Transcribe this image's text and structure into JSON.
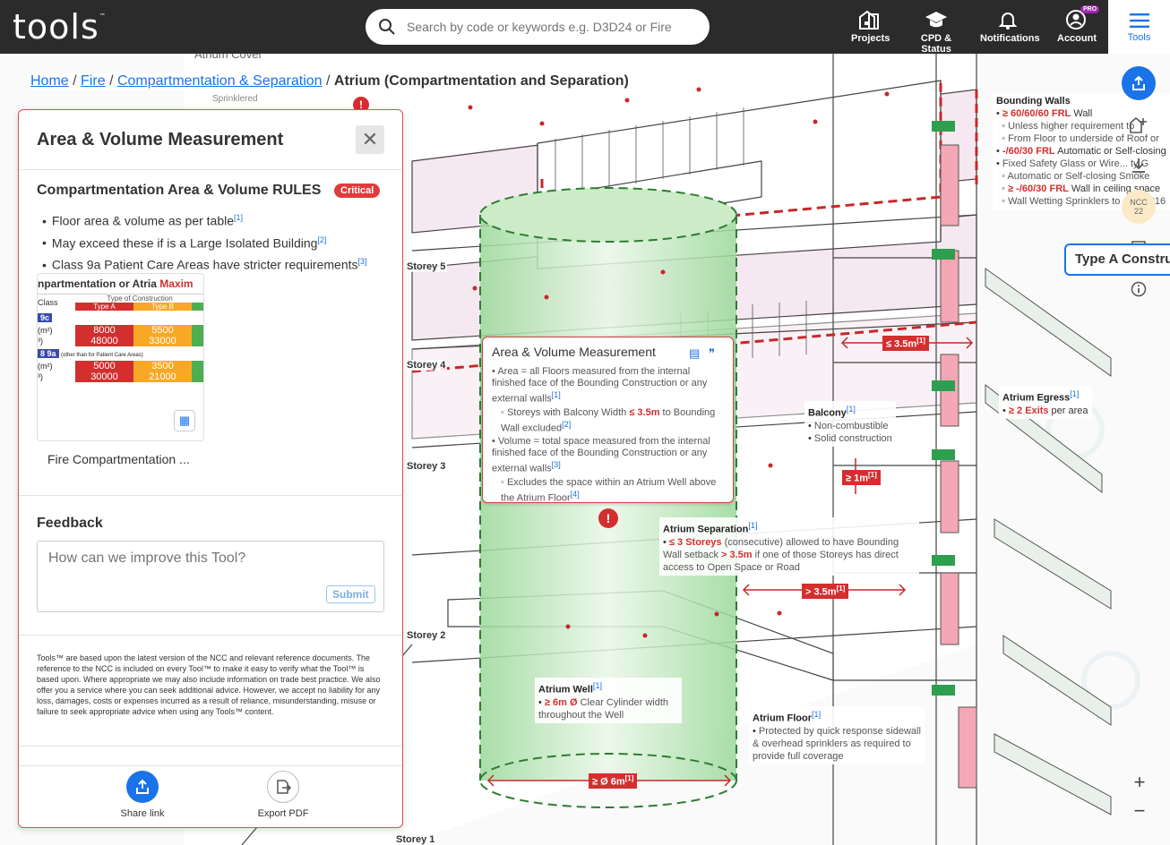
{
  "header": {
    "logo": "tools",
    "logo_tm": "™",
    "search_placeholder": "Search by code or keywords e.g. D3D24 or Fire",
    "nav": [
      {
        "label": "Projects"
      },
      {
        "label": "CPD & Status"
      },
      {
        "label": "Notifications"
      },
      {
        "label": "Account",
        "badge": "PRO"
      }
    ],
    "tools_label": "Tools"
  },
  "breadcrumb": {
    "home": "Home",
    "sep": "/",
    "fire": "Fire",
    "compartmentation": "Compartmentation & Separation",
    "current": "Atrium (Compartmentation and Separation)"
  },
  "panel": {
    "title": "Area & Volume Measurement",
    "rules_title": "Compartmentation Area & Volume RULES",
    "badge": "Critical",
    "rules": [
      {
        "text": "Floor area & volume as per table",
        "ref": "[1]"
      },
      {
        "text": "May exceed these if is a Large Isolated Building",
        "ref": "[2]"
      },
      {
        "text": "Class 9a Patient Care Areas have stricter requirements",
        "ref": "[3]"
      }
    ],
    "thumb": {
      "title_a": "npartmentation or Atria",
      "title_b": "Maxim",
      "class": "Class",
      "type_of_construction": "Type of Construction",
      "type_a": "Type A",
      "type_b": "Type B",
      "row1_label": "9c",
      "r1a_unit": "(m²)",
      "r1a_a": "8000",
      "r1a_b": "5500",
      "r1b_unit": "³)",
      "r1b_a": "48000",
      "r1b_b": "33000",
      "row2_label": "8 9a",
      "row2_note": "(other than for Patient Care Areas)",
      "r2a_unit": "(m²)",
      "r2a_a": "5000",
      "r2a_b": "3500",
      "r2b_unit": "³)",
      "r2b_a": "30000",
      "r2b_b": "21000"
    },
    "thumb_caption": "Fire Compartmentation ...",
    "feedback_title": "Feedback",
    "feedback_placeholder": "How can we improve this Tool?",
    "submit_label": "Submit",
    "disclaimer": "Tools™ are based upon the latest version of the NCC and relevant reference documents. The reference to the NCC is included on every Tool™ to make it easy to verify what the Tool™ is based upon. Where appropriate we may also include information on trade best practice. We also offer you a service where you can seek additional advice. However, we accept no liability for any loss, damages, costs or expenses incurred as a result of reliance, misunderstanding, misuse or failure to seek appropriate advice when using any Tools™ content.",
    "share_label": "Share link",
    "export_label": "Export PDF"
  },
  "right_tools": {
    "ncc_label": "NCC",
    "ncc_year": "22",
    "type_a_label": "Type A Construc"
  },
  "diagram": {
    "bg_label_1": "Atrium Cover",
    "bg_label_2": "Sprinklered",
    "storeys": [
      "Storey 5",
      "Storey 4",
      "Storey 3",
      "Storey 2",
      "Storey 1"
    ],
    "popup": {
      "title": "Area & Volume Measurement",
      "b1": "Area = all Floors measured from the internal finished face of the Bounding Construction or any external walls",
      "b1_ref": "[1]",
      "b1_sub_a": "Storeys with Balcony Width",
      "b1_sub_val": "≤ 3.5m",
      "b1_sub_b": "to Bounding Wall excluded",
      "b1_sub_ref": "[2]",
      "b2": "Volume = total space measured from the internal finished face of the Bounding Construction or any external walls",
      "b2_ref": "[3]",
      "b2_sub": "Excludes the space within an Atrium Well above the Atrium Floor",
      "b2_sub_ref": "[4]"
    },
    "bounding_walls": {
      "title": "Bounding Walls",
      "l1": "≥ 60/60/60 FRL",
      "l1b": "Wall",
      "l2": "Unless higher requirement to",
      "l3": "From Floor to underside of Roof or",
      "l4": "-/60/30 FRL",
      "l4b": "Automatic or Self-closing",
      "l5": "Fixed Safety Glass or Wire... ty G",
      "l6": "Automatic or Self-closing Smoke",
      "l7": "≥ -/60/30 FRL",
      "l7b": "Wall in ceiling space",
      "l8": "Wall Wetting Sprinklers to ... C 2016"
    },
    "atrium_egress": {
      "title": "Atrium Egress",
      "ref": "[1]",
      "val": "≥ 2 Exits",
      "rest": "per area"
    },
    "balcony": {
      "title": "Balcony",
      "ref": "[1]",
      "l1": "Non-combustible",
      "l2": "Solid construction"
    },
    "atrium_separation": {
      "title": "Atrium Separation",
      "ref": "[1]",
      "val": "≤ 3 Storeys",
      "t1": "(consecutive) allowed to have Bounding Wall setback",
      "val2": "> 3.5m",
      "t2": "if one of those Storeys has direct access to Open Space or Road"
    },
    "atrium_well": {
      "title": "Atrium Well",
      "ref": "[1]",
      "val": "≥ 6m Ø",
      "rest": "Clear Cylinder width throughout the Well"
    },
    "atrium_floor": {
      "title": "Atrium Floor",
      "ref": "[1]",
      "text": "Protected by quick response sidewall & overhead sprinklers as required to provide full coverage"
    },
    "tag_35": "≤ 3.5m",
    "tag_1m": "≥ 1m",
    "tag_gt35": "> 3.5m",
    "tag_6m": "≥ Ø 6m",
    "ref1": "[1]"
  },
  "colors": {
    "accent": "#1a73e8",
    "critical": "#e03c3c",
    "topbar": "#2b2b2b",
    "atrium_green": "#7fd07f"
  }
}
